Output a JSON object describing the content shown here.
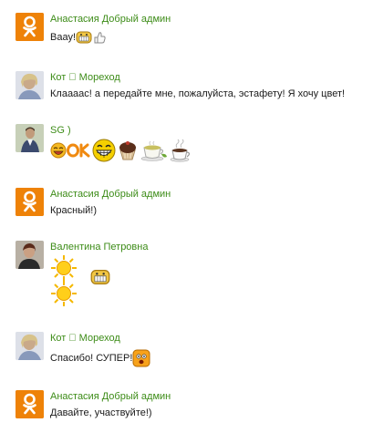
{
  "colors": {
    "author_name": "#3d8c18",
    "ok_orange": "#ee8208",
    "text": "#1a1a1a"
  },
  "comments": [
    {
      "author": "Анастасия Добрый админ",
      "avatar": "ok-logo",
      "text": "Ваау!",
      "emoticons": [
        "grinning-face-emoticon",
        "thumbs-up-emoticon"
      ]
    },
    {
      "author": "Кот ⃞ Мореход",
      "avatar": "user-photo",
      "text": "Клааааc! а передайте мне, пожалуйста, эстафету! Я хочу цвет!"
    },
    {
      "author": "SG )",
      "avatar": "user-photo",
      "emoticons": [
        "laughing-face-emoticon",
        "ok-sign-emoticon",
        "big-grin-emoticon",
        "cupcake-emoticon",
        "tea-cup-emoticon",
        "coffee-cup-emoticon"
      ]
    },
    {
      "author": "Анастасия Добрый админ",
      "avatar": "ok-logo",
      "text": "Красный!)"
    },
    {
      "author": "Валентина Петровна",
      "avatar": "user-photo",
      "emoticons": [
        "sun-emoticon",
        "grinning-face-emoticon",
        "sun-emoticon"
      ]
    },
    {
      "author": "Кот ⃞ Мореход",
      "avatar": "user-photo",
      "text": "Спасибо! СУПЕР!",
      "emoticons": [
        "surprised-face-emoticon"
      ]
    },
    {
      "author": "Анастасия Добрый админ",
      "avatar": "ok-logo",
      "text": "Давайте, участвуйте!)"
    }
  ]
}
